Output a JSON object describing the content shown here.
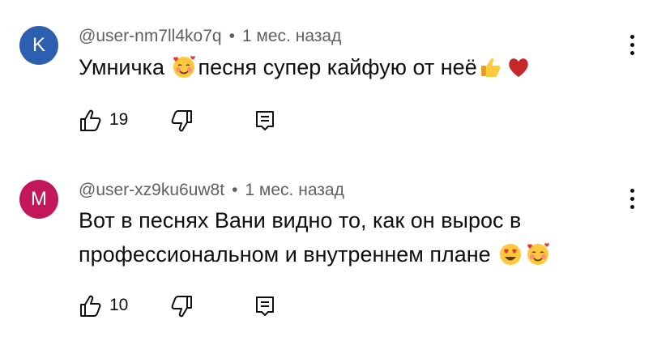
{
  "comments": [
    {
      "avatar_letter": "K",
      "avatar_color": "#2d5fb0",
      "author": "@user-nm7ll4ko7q",
      "separator": "•",
      "time": "1 мес. назад",
      "text_parts": [
        "Умничка ",
        "песня супер кайфую от неё"
      ],
      "emojis": [
        "smiling-face-with-hearts",
        "thumbs-up",
        "red-heart"
      ],
      "likes": "19"
    },
    {
      "avatar_letter": "M",
      "avatar_color": "#c2185b",
      "author": "@user-xz9ku6uw8t",
      "separator": "•",
      "time": "1 мес. назад",
      "text_line1": "Вот в песнях Вани видно то, как он вырос в",
      "text_line2": "профессиональном и внутреннем плане ",
      "emojis": [
        "heart-eyes",
        "smiling-face-with-hearts"
      ],
      "likes": "10"
    }
  ]
}
